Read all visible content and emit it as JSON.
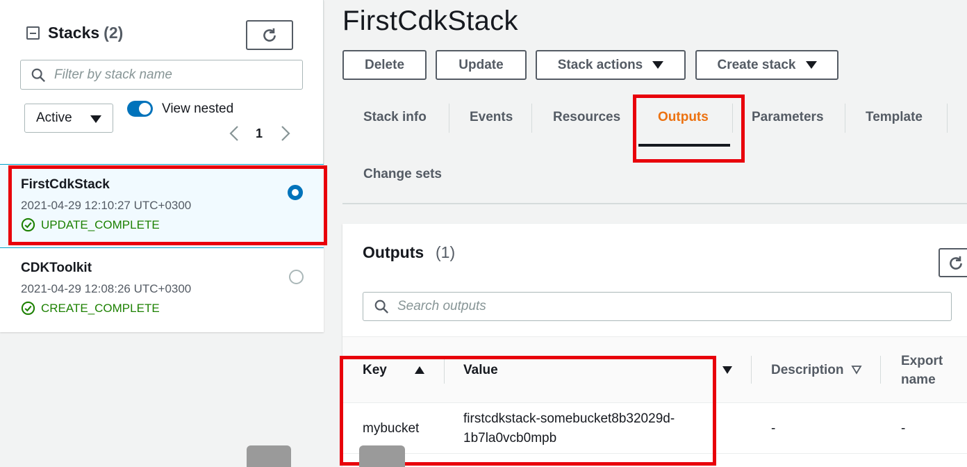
{
  "sidebar": {
    "title": "Stacks",
    "count": "(2)",
    "filter_placeholder": "Filter by stack name",
    "status_filter": "Active",
    "view_nested_label": "View nested",
    "page": "1",
    "stacks": [
      {
        "name": "FirstCdkStack",
        "date": "2021-04-29 12:10:27 UTC+0300",
        "status": "UPDATE_COMPLETE",
        "selected": true
      },
      {
        "name": "CDKToolkit",
        "date": "2021-04-29 12:08:26 UTC+0300",
        "status": "CREATE_COMPLETE",
        "selected": false
      }
    ]
  },
  "header": {
    "title": "FirstCdkStack",
    "buttons": {
      "delete": "Delete",
      "update": "Update",
      "stack_actions": "Stack actions",
      "create_stack": "Create stack"
    }
  },
  "tabs": [
    "Stack info",
    "Events",
    "Resources",
    "Outputs",
    "Parameters",
    "Template",
    "Change sets"
  ],
  "active_tab": "Outputs",
  "outputs": {
    "title": "Outputs",
    "count": "(1)",
    "search_placeholder": "Search outputs",
    "columns": {
      "key": "Key",
      "value": "Value",
      "description": "Description",
      "export_line1": "Export",
      "export_line2": "name"
    },
    "rows": [
      {
        "key": "mybucket",
        "value_line1": "firstcdkstack-somebucket8b32029d-",
        "value_line2": "1b7la0vcb0mpb",
        "description": "-",
        "export_name": "-"
      }
    ]
  },
  "colors": {
    "accent": "#ec7211",
    "selection": "#0073bb",
    "success": "#1d8102",
    "highlight": "#e8000b"
  }
}
